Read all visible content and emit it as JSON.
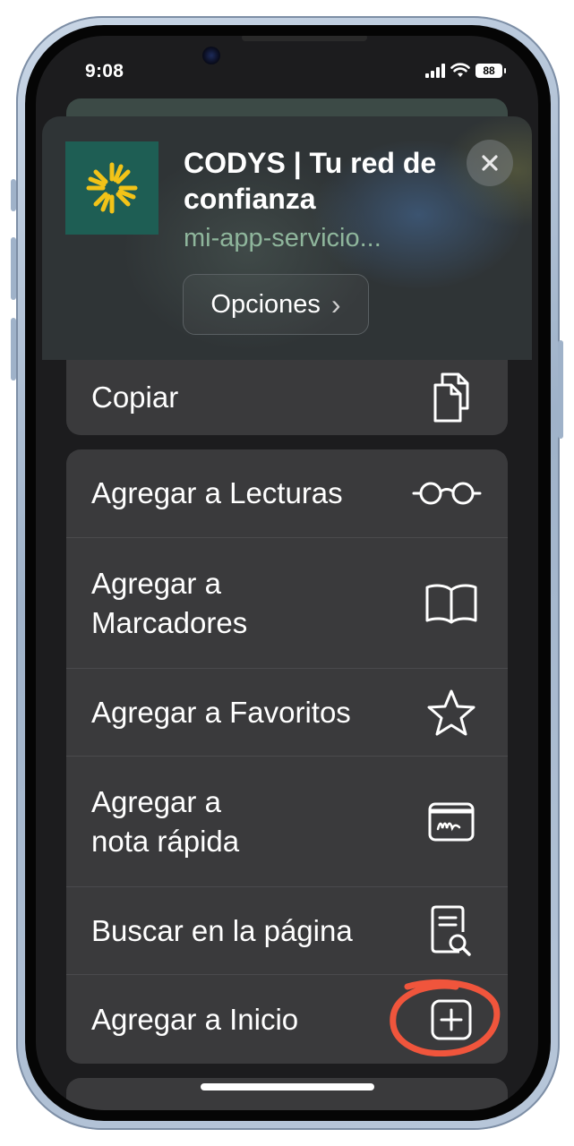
{
  "status_bar": {
    "time": "9:08",
    "battery": "88"
  },
  "share_sheet": {
    "site_title": "CODYS | Tu red de confianza",
    "site_url": "mi-app-servicio...",
    "options_label": "Opciones",
    "options_chevron": "›",
    "close_icon": "×",
    "copy": {
      "label": "Copiar",
      "icon": "doc-on-doc-icon"
    },
    "actions": [
      {
        "label": "Agregar a Lecturas",
        "icon": "eyeglasses-icon"
      },
      {
        "label": "Agregar a\nMarcadores",
        "icon": "book-icon"
      },
      {
        "label": "Agregar a Favoritos",
        "icon": "star-icon"
      },
      {
        "label": "Agregar a\nnota rápida",
        "icon": "quick-note-icon"
      },
      {
        "label": "Buscar en la página",
        "icon": "doc-magnifier-icon"
      },
      {
        "label": "Agregar a Inicio",
        "icon": "plus-square-icon"
      }
    ]
  },
  "colors": {
    "sheet_background": "#1c1c1e",
    "row_background": "#3a3a3c",
    "url_green": "#8fb69c",
    "app_icon_bg": "#1e5e54",
    "app_icon_sun": "#f2c318",
    "annotation_ring": "#f0553c"
  }
}
